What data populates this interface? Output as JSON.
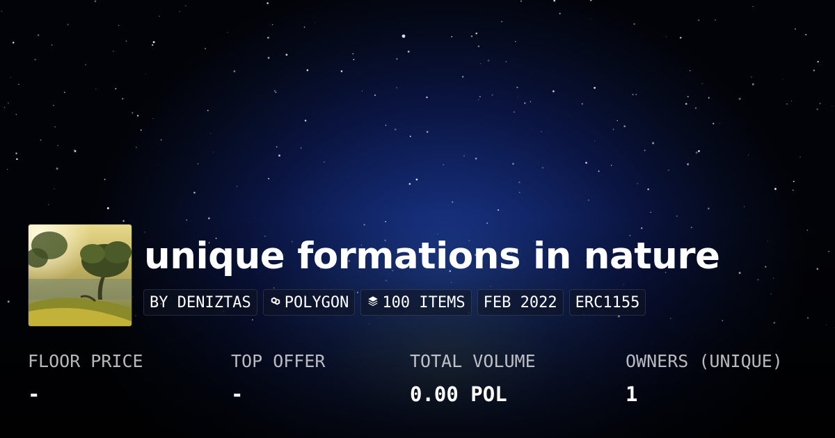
{
  "collection": {
    "title": "unique formations in nature",
    "tags": [
      {
        "label": "BY DENIZTAS",
        "icon": ""
      },
      {
        "label": "POLYGON",
        "icon": "polygon-icon"
      },
      {
        "label": "100 ITEMS",
        "icon": "layers-icon"
      },
      {
        "label": "FEB 2022",
        "icon": ""
      },
      {
        "label": "ERC1155",
        "icon": ""
      }
    ]
  },
  "stats": [
    {
      "label": "FLOOR PRICE",
      "value": "-"
    },
    {
      "label": "TOP OFFER",
      "value": "-"
    },
    {
      "label": "TOTAL VOLUME",
      "value": "0.00 POL"
    },
    {
      "label": "OWNERS (UNIQUE)",
      "value": "1"
    }
  ],
  "colors": {
    "text": "#ffffff",
    "sky_center": "#1b3a8f",
    "background": "#020308"
  }
}
